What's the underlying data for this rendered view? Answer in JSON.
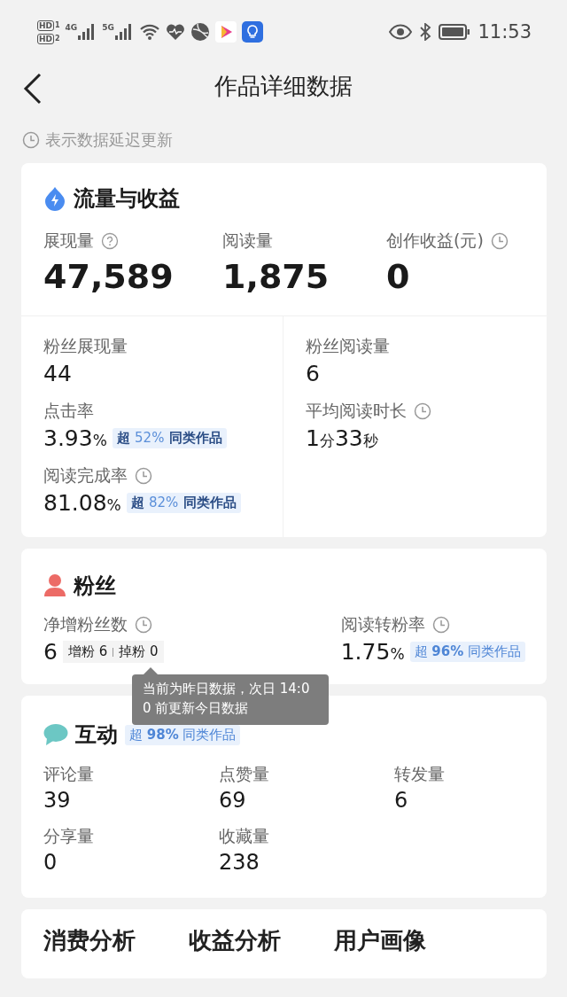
{
  "status_bar": {
    "sims": [
      {
        "badge": "HD",
        "slot": "1",
        "network": "4G"
      },
      {
        "badge": "HD",
        "slot": "2",
        "network": "5G"
      }
    ],
    "time": "11:53"
  },
  "header": {
    "title": "作品详细数据"
  },
  "notice": "表示数据延迟更新",
  "sections": [
    {
      "kind": "traffic",
      "title": "流量与收益",
      "top_metrics": [
        {
          "label": "展现量",
          "help": true,
          "value": "47,589"
        },
        {
          "label": "阅读量",
          "value": "1,875"
        },
        {
          "label": "创作收益(元)",
          "clock": true,
          "value": "0"
        }
      ],
      "columns": [
        [
          {
            "label": "粉丝展现量",
            "value": [
              {
                "number": "44"
              }
            ]
          },
          {
            "label": "点击率",
            "value": [
              {
                "number": "3.93",
                "unit": "%"
              }
            ],
            "badge": {
              "prefix": "超",
              "highlight": "52%",
              "suffix": "同类作品",
              "bold_text": true
            }
          },
          {
            "label": "阅读完成率",
            "clock": true,
            "value": [
              {
                "number": "81.08",
                "unit": "%"
              }
            ],
            "badge": {
              "prefix": "超",
              "highlight": "82%",
              "suffix": "同类作品",
              "bold_text": true
            }
          }
        ],
        [
          {
            "label": "粉丝阅读量",
            "value": [
              {
                "number": "6"
              }
            ]
          },
          {
            "label": "平均阅读时长",
            "clock": true,
            "value": [
              {
                "number": "1",
                "unit": "分"
              },
              {
                "number": "33",
                "unit": "秒"
              }
            ]
          }
        ]
      ]
    },
    {
      "kind": "fans",
      "title": "粉丝",
      "metrics": [
        {
          "label": "净增粉丝数",
          "clock": true,
          "value": [
            {
              "number": "6"
            }
          ],
          "detail": [
            "增粉 6",
            "掉粉 0"
          ]
        },
        {
          "label": "阅读转粉率",
          "clock": true,
          "value": [
            {
              "number": "1.75",
              "unit": "%"
            }
          ],
          "badge": {
            "prefix": "超",
            "highlight": "96%",
            "suffix": "同类作品",
            "bold_text": false
          }
        }
      ],
      "tooltip": [
        "当前为昨日数据，次日 14:0",
        "0 前更新今日数据"
      ]
    },
    {
      "kind": "interaction",
      "title": "互动",
      "badge": {
        "prefix": "超",
        "highlight": "98%",
        "suffix": "同类作品",
        "bold_text": false
      },
      "metrics": [
        {
          "label": "评论量",
          "value": "39"
        },
        {
          "label": "点赞量",
          "value": "69"
        },
        {
          "label": "转发量",
          "value": "6"
        },
        {
          "label": "分享量",
          "value": "0"
        },
        {
          "label": "收藏量",
          "value": "238"
        }
      ]
    },
    {
      "kind": "tabs",
      "tabs": [
        "消费分析",
        "收益分析",
        "用户画像"
      ]
    }
  ]
}
